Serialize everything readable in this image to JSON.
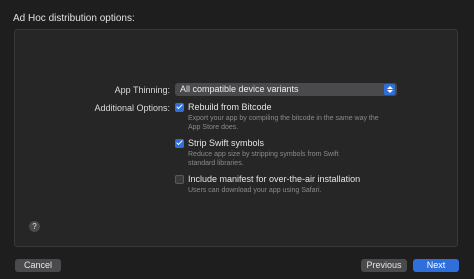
{
  "header": {
    "title": "Ad Hoc distribution options:"
  },
  "app_thinning": {
    "label": "App Thinning:",
    "selected": "All compatible device variants"
  },
  "additional_options": {
    "label": "Additional Options:",
    "options": [
      {
        "title": "Rebuild from Bitcode",
        "desc_line1": "Export your app by compiling the bitcode in the same way the",
        "desc_line2": "App Store does.",
        "checked": true
      },
      {
        "title": "Strip Swift symbols",
        "desc_line1": "Reduce app size by stripping symbols from Swift",
        "desc_line2": "standard libraries.",
        "checked": true
      },
      {
        "title": "Include manifest for over-the-air installation",
        "desc_line1": "Users can download your app using Safari.",
        "desc_line2": "",
        "checked": false
      }
    ]
  },
  "help": {
    "glyph": "?"
  },
  "footer": {
    "cancel_label": "Cancel",
    "previous_label": "Previous",
    "next_label": "Next"
  },
  "colors": {
    "accent": "#2f6fdc",
    "background": "#1e1e1e",
    "panel": "#262626"
  }
}
